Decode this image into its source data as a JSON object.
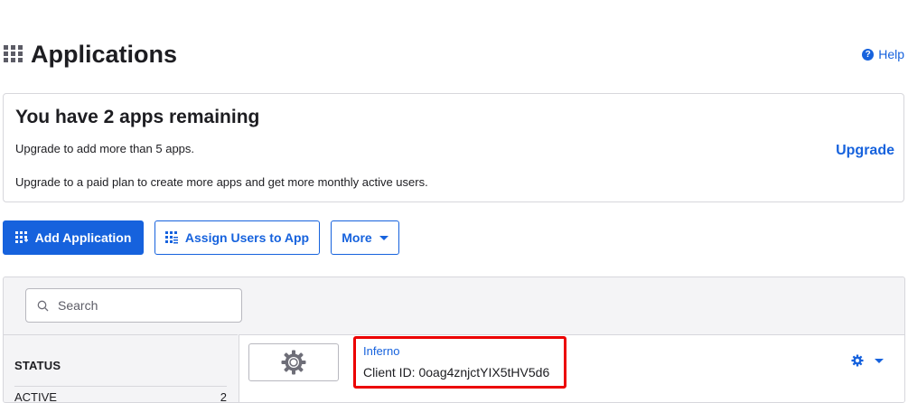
{
  "header": {
    "title": "Applications",
    "help_label": "Help",
    "title_icon": "apps-grid-icon",
    "help_icon": "question-circle-icon"
  },
  "banner": {
    "title": "You have 2 apps remaining",
    "line1": "Upgrade to add more than 5 apps.",
    "line2": "Upgrade to a paid plan to create more apps and get more monthly active users.",
    "upgrade_label": "Upgrade"
  },
  "actions": {
    "add_application": "Add Application",
    "assign_users": "Assign Users to App",
    "more": "More"
  },
  "search": {
    "placeholder": "Search"
  },
  "filters": {
    "status_heading": "STATUS",
    "active_label": "ACTIVE",
    "active_count": "2"
  },
  "apps": [
    {
      "name": "Inferno",
      "client_id_text": "Client ID: 0oag4znjctYIX5tHV5d6"
    }
  ],
  "colors": {
    "accent": "#1662dd",
    "highlight": "#ec0000",
    "border": "#d7d7dc"
  }
}
